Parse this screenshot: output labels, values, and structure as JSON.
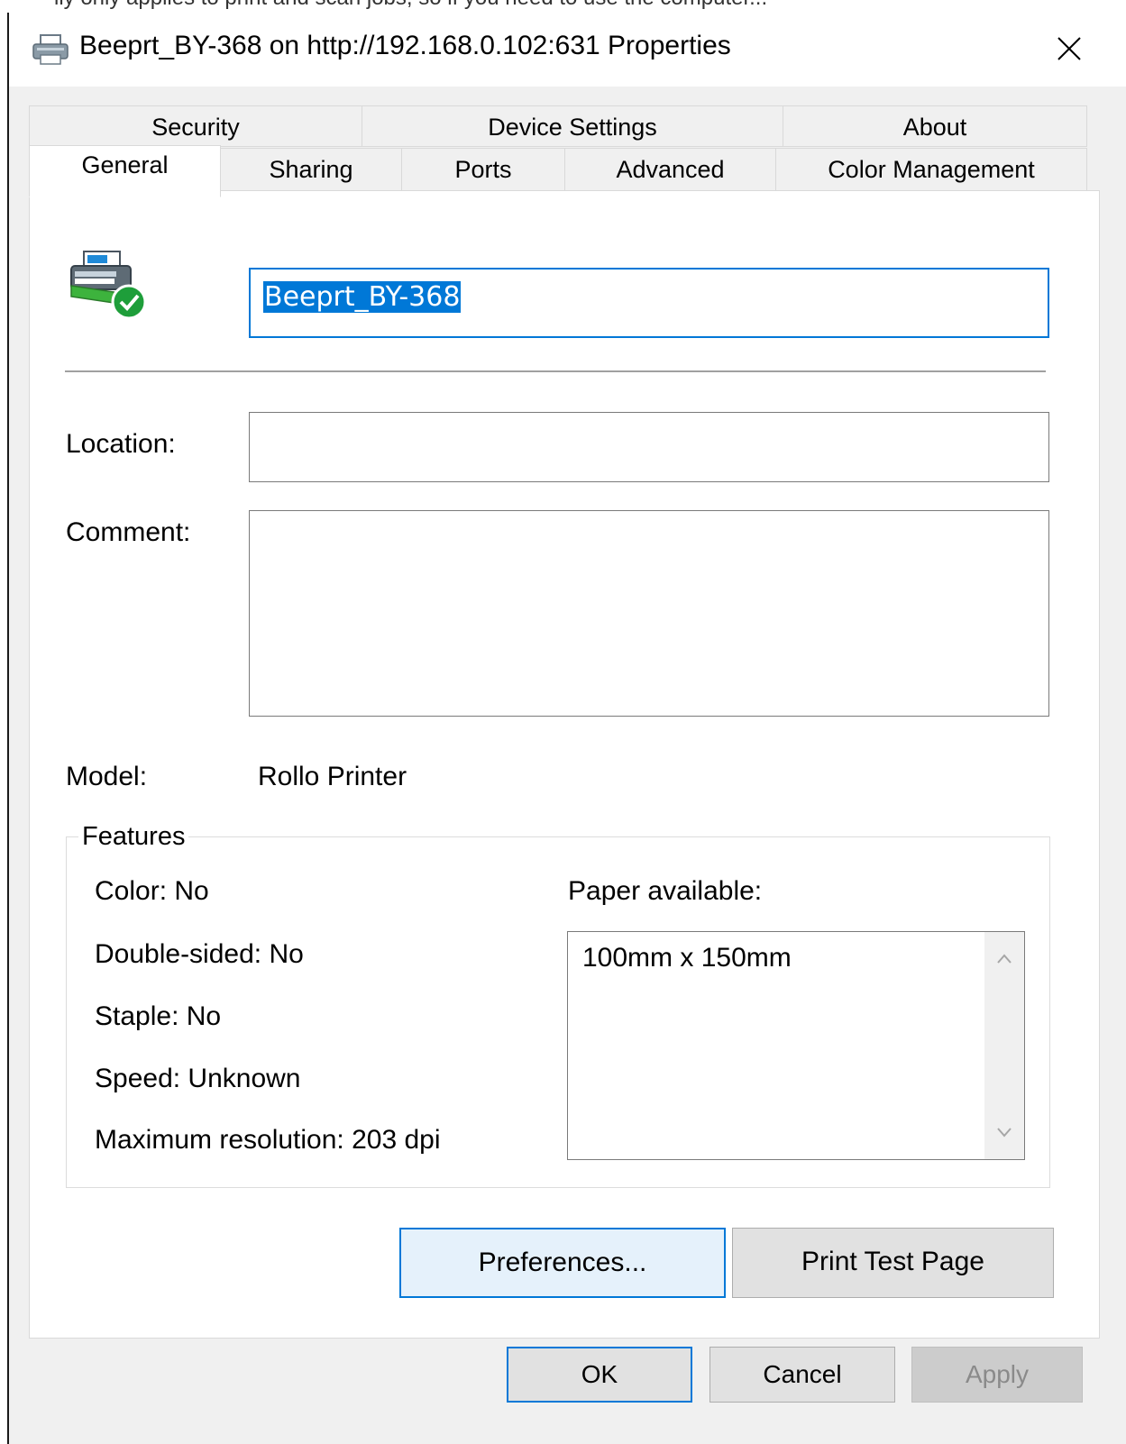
{
  "window": {
    "title": "Beeprt_BY-368 on http://192.168.0.102:631 Properties",
    "top_strip_text": "ily only applies to print and scan jobs, so if you need to use the computer..."
  },
  "tabs": {
    "back_row": [
      "Security",
      "Device Settings",
      "About"
    ],
    "front_row": [
      "General",
      "Sharing",
      "Ports",
      "Advanced",
      "Color Management"
    ],
    "selected": "General"
  },
  "general": {
    "printer_name": "Beeprt_BY-368",
    "location_label": "Location:",
    "location_value": "",
    "comment_label": "Comment:",
    "comment_value": "",
    "model_label": "Model:",
    "model_value": "Rollo Printer"
  },
  "features": {
    "title": "Features",
    "color": "Color: No",
    "double_sided": "Double-sided: No",
    "staple": "Staple: No",
    "speed": "Speed: Unknown",
    "max_resolution": "Maximum resolution: 203 dpi",
    "paper_label": "Paper available:",
    "paper_items": [
      "100mm x 150mm"
    ]
  },
  "buttons": {
    "preferences": "Preferences...",
    "print_test_page": "Print Test Page",
    "ok": "OK",
    "cancel": "Cancel",
    "apply": "Apply"
  },
  "colors": {
    "accent": "#0078d7",
    "dialog_bg": "#f0f0f0",
    "panel_bg": "#ffffff",
    "disabled_text": "#8a8a8a"
  },
  "icons": {
    "title": "printer-icon",
    "close": "close-icon",
    "main": "printer-ready-icon"
  }
}
